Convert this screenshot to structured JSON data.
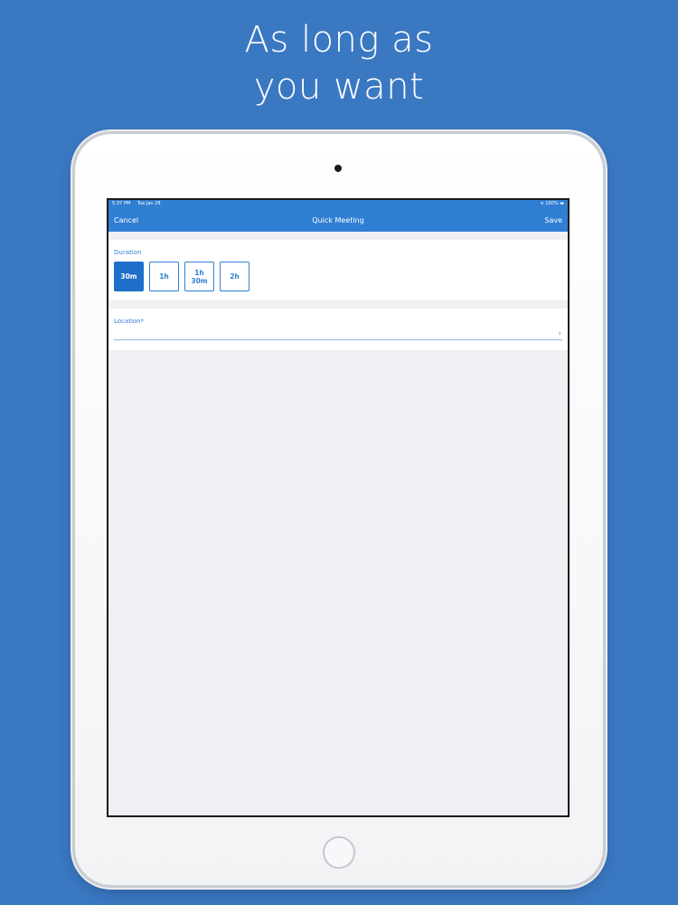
{
  "headline": {
    "line1": "As long as",
    "line2": "you want"
  },
  "status_bar": {
    "time": "5:37 PM",
    "date": "Tue Jan 28",
    "battery": "100%"
  },
  "nav": {
    "cancel": "Cancel",
    "title": "Quick Meeting",
    "save": "Save"
  },
  "duration": {
    "label": "Duration",
    "options": [
      "30m",
      "1h",
      "1h\n30m",
      "2h"
    ],
    "selected": "30m"
  },
  "location": {
    "label": "Location*",
    "value": ""
  },
  "colors": {
    "background": "#3a78c2",
    "accent": "#2f7fd3",
    "selected": "#1e6fc9"
  }
}
